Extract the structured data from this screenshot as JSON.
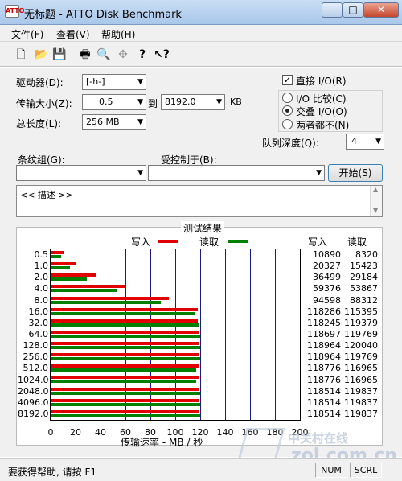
{
  "window": {
    "icon_text": "ATTO",
    "title": "无标题 - ATTO Disk Benchmark",
    "min": "—",
    "max": "□",
    "close": "✕"
  },
  "menu": [
    "文件(F)",
    "查看(V)",
    "帮助(H)"
  ],
  "toolbar": [
    "new-icon",
    "open-icon",
    "save-icon",
    "print-icon",
    "print-preview-icon",
    "move-icon",
    "help-icon",
    "context-help-icon"
  ],
  "settings": {
    "drive_label": "驱动器(D):",
    "drive_value": "[-h-]",
    "transfer_label": "传输大小(Z):",
    "transfer_from": "0.5",
    "to_label": "到",
    "transfer_to": "8192.0",
    "kb_label": "KB",
    "total_label": "总长度(L):",
    "total_value": "256 MB",
    "direct_io_label": "直接 I/O(R)",
    "direct_io_checked": true,
    "io_compare_label": "I/O 比较(C)",
    "overlap_io_label": "交叠 I/O(O)",
    "neither_label": "两者都不(N)",
    "selected_mode": "overlap",
    "queue_label": "队列深度(Q):",
    "queue_value": "4",
    "stripe_label": "条纹组(G):",
    "controlled_label": "受控制于(B):",
    "start_label": "开始(S)",
    "desc_text": "<< 描述 >>"
  },
  "results": {
    "title": "测试结果",
    "write_label": "写入",
    "read_label": "读取",
    "write_col": "写入",
    "read_col": "读取",
    "x_axis_label": "传输速率 - MB / 秒",
    "write_color": "#e00000",
    "read_color": "#008000"
  },
  "chart_data": {
    "type": "bar",
    "title": "测试结果",
    "xlabel": "传输速率 - MB / 秒",
    "xlim": [
      0,
      200
    ],
    "x_ticks": [
      "0",
      "20",
      "40",
      "60",
      "80",
      "100",
      "120",
      "140",
      "160",
      "180",
      "200"
    ],
    "categories": [
      "0.5",
      "1.0",
      "2.0",
      "4.0",
      "8.0",
      "16.0",
      "32.0",
      "64.0",
      "128.0",
      "256.0",
      "512.0",
      "1024.0",
      "2048.0",
      "4096.0",
      "8192.0"
    ],
    "series": [
      {
        "name": "写入",
        "values": [
          10890,
          20327,
          36499,
          59376,
          94598,
          118286,
          118245,
          118697,
          118964,
          118964,
          118776,
          118776,
          118514,
          118514,
          118514
        ]
      },
      {
        "name": "读取",
        "values": [
          8320,
          15423,
          29184,
          53867,
          88312,
          115395,
          119379,
          119769,
          120040,
          119769,
          116965,
          116965,
          119837,
          119837,
          119837
        ]
      }
    ]
  },
  "status": {
    "help": "要获得帮助, 请按 F1",
    "num": "NUM",
    "scrl": "SCRL"
  },
  "watermark": {
    "cn": "中关村在线",
    "en": "zol.com.cn"
  }
}
